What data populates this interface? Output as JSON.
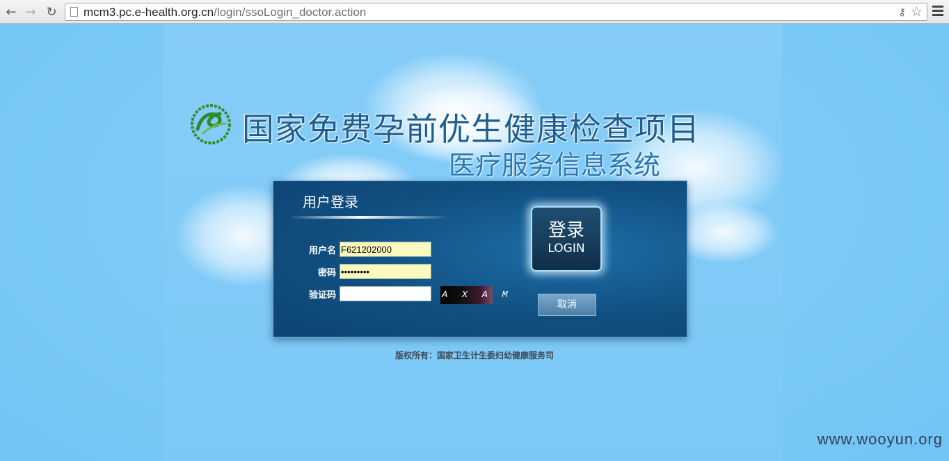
{
  "browser": {
    "url_host": "mcm3.pc.e-health.org.cn",
    "url_path": "/login/ssoLogin_doctor.action"
  },
  "header": {
    "title": "国家免费孕前优生健康检查项目",
    "subtitle": "医疗服务信息系统"
  },
  "login": {
    "title": "用户登录",
    "username_label": "用户名",
    "username_value": "F621202000",
    "password_label": "密码",
    "password_value": "•••••••••",
    "captcha_label": "验证码",
    "captcha_value": "",
    "captcha_text": "A X A M",
    "login_button_cn": "登录",
    "login_button_en": "LOGIN",
    "cancel_button": "取消"
  },
  "footer": {
    "copyright": "版权所有：国家卫生计生委妇幼健康服务司"
  },
  "watermark": "www.wooyun.org",
  "colors": {
    "page_bg": "#7cc8f6",
    "login_panel": "#114f80",
    "title_text": "#1f5f8f",
    "input_autofill": "#fafabf"
  }
}
